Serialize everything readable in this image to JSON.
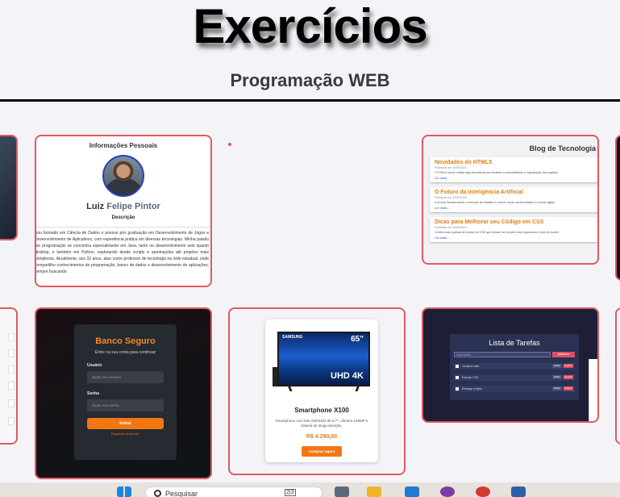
{
  "header": {
    "title": "Exercícios",
    "subtitle": "Programação WEB"
  },
  "personal_card": {
    "heading": "Informações Pessoais",
    "first_name": "Luiz",
    "last_name": "Felipe Pintor",
    "desc_heading": "Descrição",
    "description": "Sou formado em Ciência de Dados e possuo pós graduação em Desenvolvimento de Jogos e Desenvolvimento de Aplicativos, com experiência prática em diversas tecnologias. Minha paixão por programação se concentra especialmente em Java, tanto no desenvolvimento web quanto desktop, e também em Python, explorando desde scripts e automações até projetos mais complexos. Atualmente, aos 32 anos, atuo como professor de tecnologia na rede estadual, onde compartilho conhecimentos de programação, banco de dados e desenvolvimento de aplicações, sempre buscando"
  },
  "blog_card": {
    "title": "Blog de Tecnologia",
    "posts": [
      {
        "title": "Novidades do HTML5",
        "date": "Publicado em 10/05/2024",
        "text": "O HTML5 trouxe muitas tags semânticas que facilitam a acessibilidade e organização das páginas.",
        "link": "Ler mais..."
      },
      {
        "title": "O Futuro da Inteligência Artificial",
        "date": "Publicado em 12/05/2024",
        "text": "A IA está transformando o mercado de trabalho e criando novas oportunidades no mundo digital.",
        "link": "Ler mais..."
      },
      {
        "title": "Dicas para Melhorar seu Código em CSS",
        "date": "Publicado em 15/05/2024",
        "text": "Confira boas práticas de escrita em CSS que deixam seu projeto mais organizado e fácil de manter.",
        "link": "Ler mais..."
      }
    ]
  },
  "bank_card": {
    "title": "Banco Seguro",
    "subtitle": "Entre na sua conta para continuar",
    "user_label": "Usuário",
    "user_placeholder": "Digite seu usuário",
    "pass_label": "Senha",
    "pass_placeholder": "Digite sua senha",
    "submit": "Entrar",
    "forgot": "Esqueceu a senha?"
  },
  "product_card": {
    "tv_brand": "SAMSUNG",
    "tv_size": "65\"",
    "tv_badge": "UHD 4K",
    "name": "Smartphone X100",
    "description": "Smartphone com tela AMOLED de 6.7\", câmera 108MP e bateria de longa duração.",
    "price": "R$ 4.290,00",
    "buy": "Comprar Agora"
  },
  "todo_card": {
    "title": "Lista de Tarefas",
    "input_placeholder": "Nova tarefa...",
    "add": "Adicionar",
    "tasks": [
      {
        "label": "Comprar café",
        "edit": "Editar",
        "remove": "Excluir"
      },
      {
        "label": "Estudar CSS",
        "edit": "Editar",
        "remove": "Excluir"
      },
      {
        "label": "Entregar projeto",
        "edit": "Editar",
        "remove": "Excluir"
      }
    ]
  },
  "taskbar": {
    "search_placeholder": "Pesquisar",
    "search_badge": "2|3"
  },
  "colors": {
    "card_border": "#e05a5f",
    "accent_orange": "#f27712",
    "page_bg": "#f4f3f8"
  }
}
